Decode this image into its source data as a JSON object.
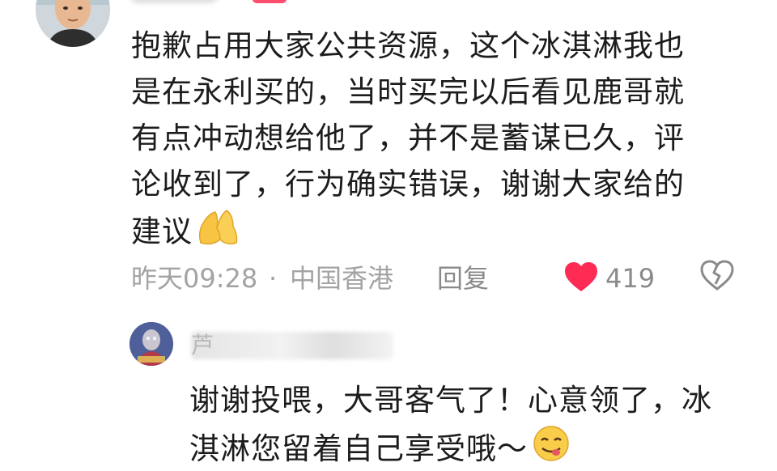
{
  "comment": {
    "text_lines": [
      "抱歉占用大家公共资源，这个冰淇淋我也",
      "是在永利买的，当时买完以后看见鹿哥就",
      "有点冲动想给他了，并不是蓄谋已久，评",
      "论收到了，行为确实错误，谢谢大家给的",
      "建议"
    ],
    "trailing_emoji": "folded-hands-emoji",
    "time": "昨天09:28",
    "separator": "·",
    "location": "中国香港",
    "reply_label": "回复",
    "like_count": "419",
    "like_color": "#fe2c55"
  },
  "reply": {
    "author_name": "芦",
    "text_lines": [
      "谢谢投喂，大哥客气了！心意领了，冰",
      "淇淋您留着自己享受哦～"
    ],
    "trailing_emoji": "face-savoring-food-emoji"
  }
}
